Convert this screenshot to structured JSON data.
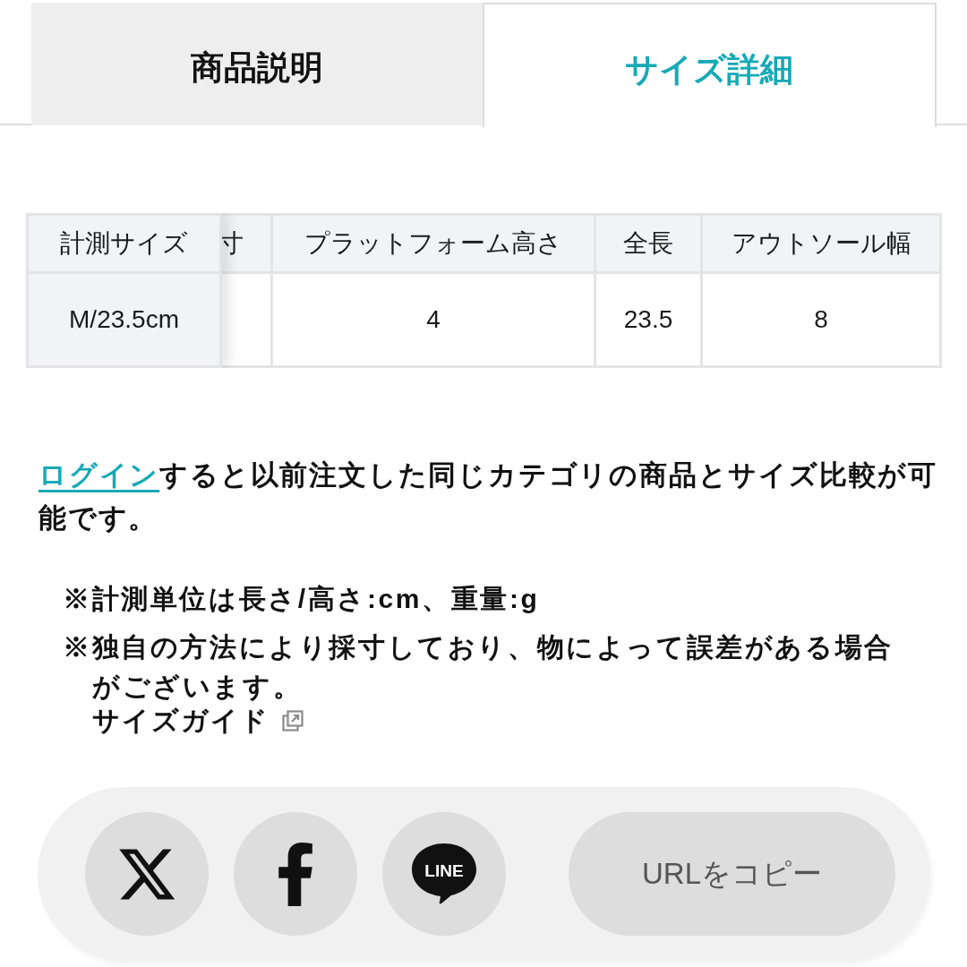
{
  "tabs": [
    {
      "label": "商品説明",
      "selected": false
    },
    {
      "label": "サイズ詳細",
      "selected": true
    }
  ],
  "size_table": {
    "columns": [
      {
        "label": "計測サイズ",
        "frozen": true
      },
      {
        "label": "寸",
        "frozen": false
      },
      {
        "label": "プラットフォーム高さ",
        "frozen": false
      },
      {
        "label": "全長",
        "frozen": false
      },
      {
        "label": "アウトソール幅",
        "frozen": false
      }
    ],
    "rows": [
      {
        "cells": [
          "M/23.5cm",
          null,
          "4",
          "23.5",
          "8"
        ]
      }
    ]
  },
  "login_note": {
    "link": "ログイン",
    "text": "すると以前注文した同じカテゴリの商品とサイズ比較が可能です。"
  },
  "notes": [
    "※計測単位は長さ/高さ:cm、重量:g",
    "※独自の方法により採寸しており、物によって誤差がある場合がございます。"
  ],
  "size_guide_link": "サイズガイド",
  "share": {
    "buttons": [
      {
        "kind": "x"
      },
      {
        "kind": "facebook"
      },
      {
        "kind": "line",
        "logo_text": "LINE"
      }
    ],
    "copy_button": "URLをコピー"
  }
}
